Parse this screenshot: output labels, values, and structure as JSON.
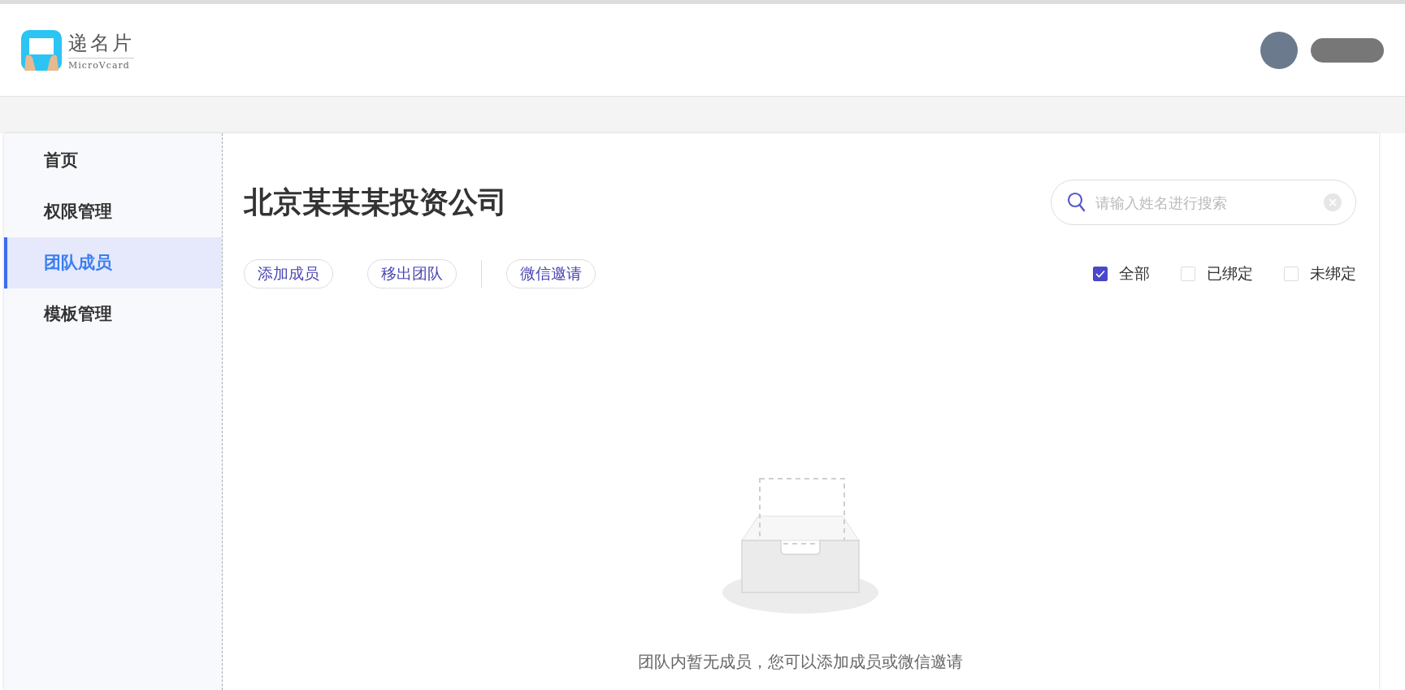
{
  "header": {
    "logo": {
      "name": "递名片",
      "subtitle": "MicroVcard"
    },
    "user": {
      "name_redacted": true
    }
  },
  "sidebar": {
    "items": [
      {
        "label": "首页",
        "selected": false
      },
      {
        "label": "权限管理",
        "selected": false
      },
      {
        "label": "团队成员",
        "selected": true
      },
      {
        "label": "模板管理",
        "selected": false
      }
    ]
  },
  "main": {
    "title": "北京某某某投资公司",
    "search": {
      "placeholder": "请输入姓名进行搜索"
    },
    "actions": [
      {
        "label": "添加成员",
        "divider_before": false
      },
      {
        "label": "移出团队",
        "divider_before": false
      },
      {
        "label": "微信邀请",
        "divider_before": true
      }
    ],
    "filters": [
      {
        "label": "全部",
        "checked": true
      },
      {
        "label": "已绑定",
        "checked": false
      },
      {
        "label": "未绑定",
        "checked": false
      }
    ],
    "empty_message": "团队内暂无成员，您可以添加成员或微信邀请"
  }
}
